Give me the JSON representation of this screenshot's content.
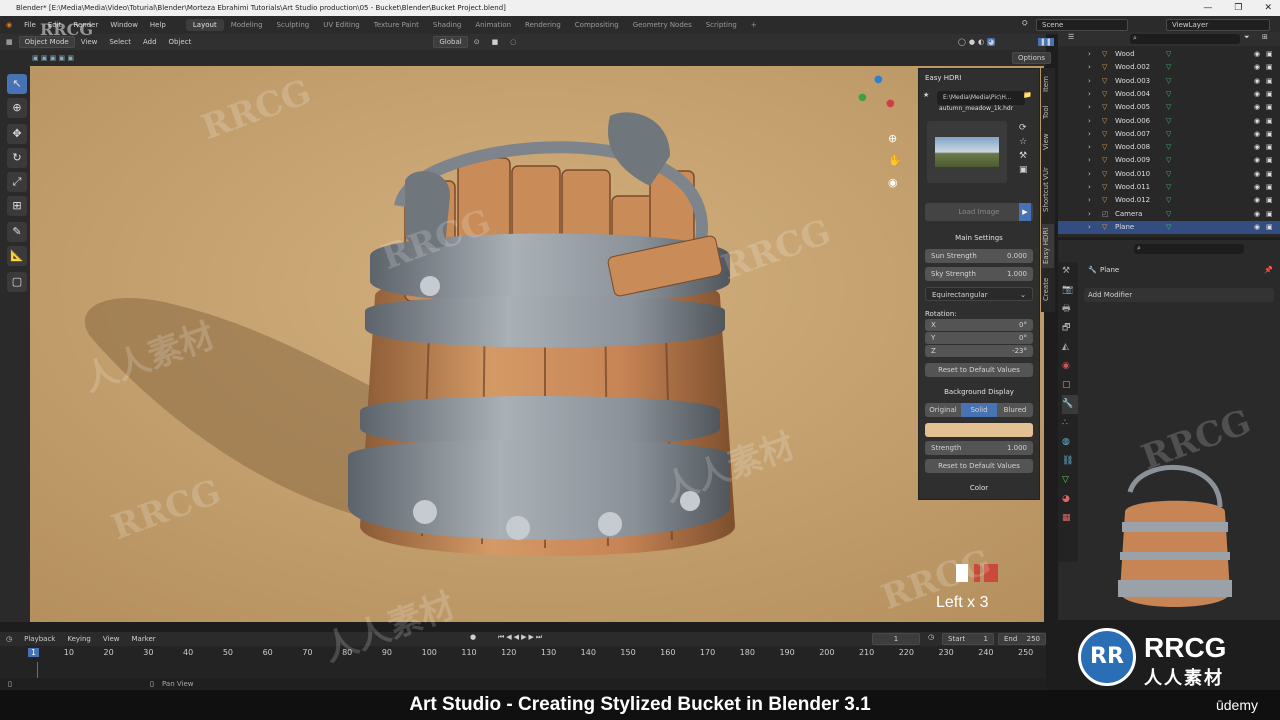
{
  "window": {
    "title": "Blender* [E:\\Media\\Media\\Video\\Toturial\\Blender\\Morteza Ebrahimi Tutorials\\Art Studio production\\05 - Bucket\\Blender\\Bucket Project.blend]"
  },
  "menu": [
    "File",
    "Edit",
    "Render",
    "Window",
    "Help"
  ],
  "workspaces": [
    "Layout",
    "Modeling",
    "Sculpting",
    "UV Editing",
    "Texture Paint",
    "Shading",
    "Animation",
    "Rendering",
    "Compositing",
    "Geometry Nodes",
    "Scripting"
  ],
  "scene": {
    "label": "Scene",
    "view_layer": "ViewLayer"
  },
  "viewport_header": {
    "mode": "Object Mode",
    "items": [
      "View",
      "Select",
      "Add",
      "Object"
    ],
    "orientation": "Global",
    "options": "Options"
  },
  "easy_hdri": {
    "title": "Easy HDRI",
    "path": "E:\\Media\\Media\\Pic\\H...",
    "file": "autumn_meadow_1k.hdr",
    "load_image": "Load Image",
    "main_settings": "Main Settings",
    "sun_strength_label": "Sun Strength",
    "sun_strength": "0.000",
    "sky_strength_label": "Sky Strength",
    "sky_strength": "1.000",
    "projection": "Equirectangular",
    "rotation_label": "Rotation:",
    "rx_label": "X",
    "rx": "0°",
    "ry_label": "Y",
    "ry": "0°",
    "rz_label": "Z",
    "rz": "-23°",
    "reset": "Reset to Default Values",
    "background_display": "Background Display",
    "bg_options": [
      "Original",
      "Solid",
      "Blured"
    ],
    "bg_selected": "Solid",
    "strength_label": "Strength",
    "strength": "1.000",
    "color_label": "Color",
    "bg_color": "#e3c192"
  },
  "side_tabs": [
    "Item",
    "Tool",
    "View",
    "Shortcut VUr",
    "Easy HDRI",
    "Create"
  ],
  "outliner": {
    "items": [
      "Wood",
      "Wood.002",
      "Wood.003",
      "Wood.004",
      "Wood.005",
      "Wood.006",
      "Wood.007",
      "Wood.008",
      "Wood.009",
      "Wood.010",
      "Wood.011",
      "Wood.012",
      "Camera",
      "Plane"
    ],
    "selected": "Plane"
  },
  "properties": {
    "object": "Plane",
    "add_modifier": "Add Modifier"
  },
  "key_overlay": "Left x 3",
  "timeline": {
    "menu": [
      "Playback",
      "Keying",
      "View",
      "Marker"
    ],
    "current_frame": "1",
    "start_label": "Start",
    "start": "1",
    "end_label": "End",
    "end": "250",
    "ticks": [
      "1",
      "10",
      "20",
      "30",
      "40",
      "50",
      "60",
      "70",
      "80",
      "90",
      "100",
      "110",
      "120",
      "130",
      "140",
      "150",
      "160",
      "170",
      "180",
      "190",
      "200",
      "210",
      "220",
      "230",
      "240",
      "250"
    ]
  },
  "status": {
    "pan_view": "Pan View"
  },
  "caption": "Art Studio - Creating Stylized Bucket in Blender 3.1",
  "brand": {
    "name": "RRCG",
    "sub": "人人素材",
    "udemy": "ūdemy"
  },
  "colors": {
    "viewport_bg": "#c09d6c",
    "accent": "#4772b3"
  }
}
